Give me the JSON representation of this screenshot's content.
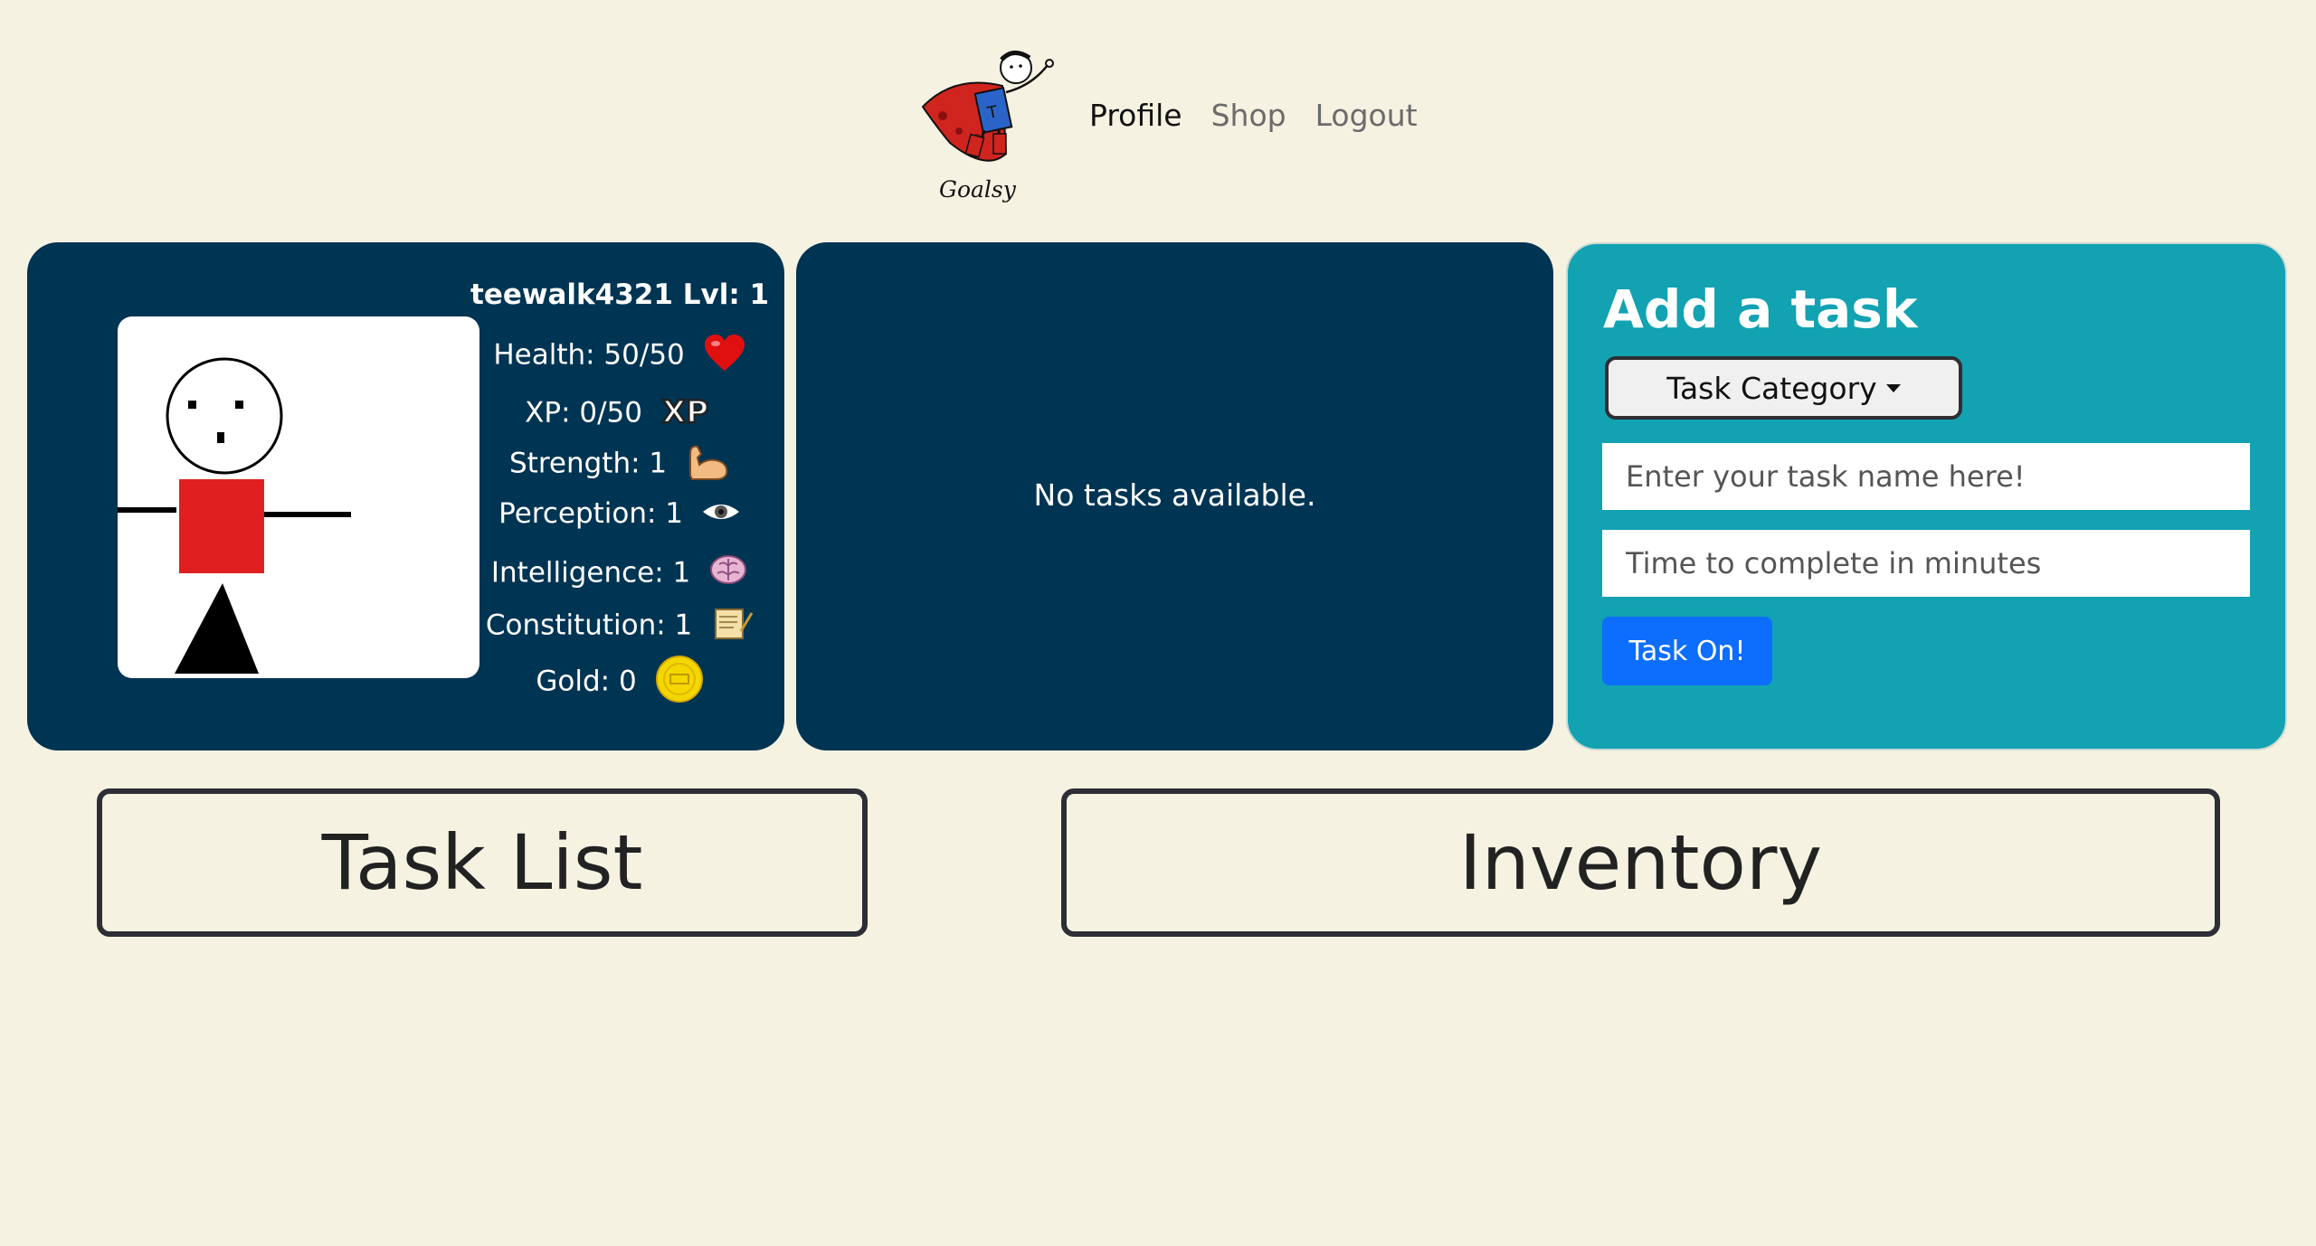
{
  "header": {
    "logo_text": "Goalsy",
    "nav": [
      {
        "label": "Profile",
        "active": true
      },
      {
        "label": "Shop",
        "active": false
      },
      {
        "label": "Logout",
        "active": false
      }
    ]
  },
  "profile": {
    "username_level": "teewalk4321 Lvl: 1",
    "stats": {
      "health": "Health: 50/50",
      "xp": "XP: 0/50",
      "strength": "Strength: 1",
      "perception": "Perception: 1",
      "intelligence": "Intelligence: 1",
      "constitution": "Constitution: 1",
      "gold": "Gold: 0"
    },
    "icons": [
      "heart-icon",
      "xp-icon",
      "muscle-icon",
      "eye-icon",
      "brain-icon",
      "scroll-icon",
      "coin-icon"
    ]
  },
  "tasks_panel": {
    "empty_message": "No tasks available."
  },
  "add_task": {
    "title": "Add a task",
    "category_button": "Task Category",
    "name_placeholder": "Enter your task name here!",
    "time_placeholder": "Time to complete in minutes",
    "submit_label": "Task On!"
  },
  "sections": {
    "task_list": "Task List",
    "inventory": "Inventory"
  },
  "colors": {
    "background": "#f6f2e1",
    "card_dark": "#003453",
    "card_teal": "#12a2b2",
    "primary_button": "#0d6efd"
  }
}
